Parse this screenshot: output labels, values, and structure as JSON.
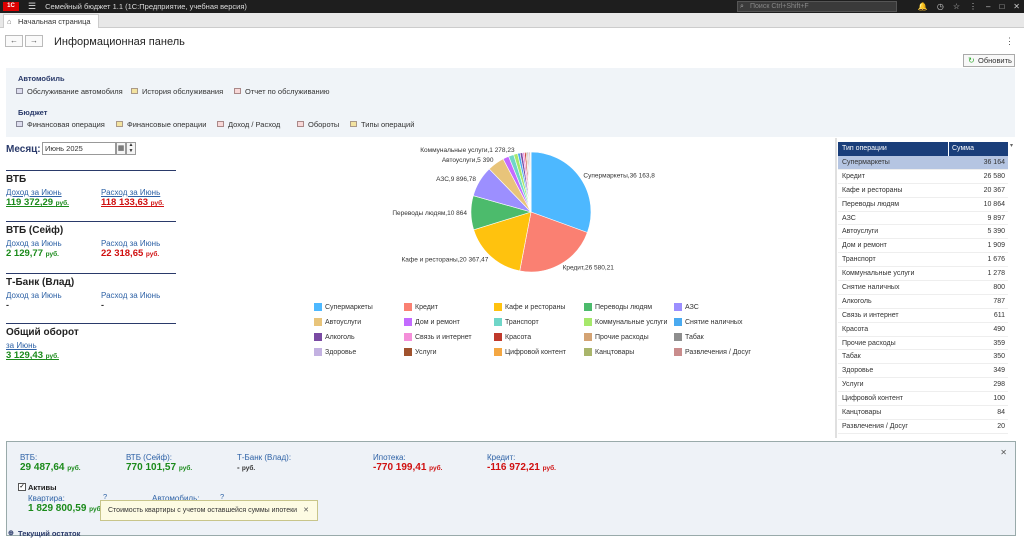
{
  "app": {
    "logo_text": "1C",
    "title": "Семейный бюджет 1.1  (1С:Предприятие, учебная версия)",
    "search_placeholder": "Поиск Ctrl+Shift+F"
  },
  "tabs": {
    "home": "Начальная страница"
  },
  "header": {
    "title": "Информационная панель",
    "refresh": "Обновить"
  },
  "nav_panel": {
    "auto_group": "Автомобиль",
    "auto_links": [
      "Обслуживание автомобиля",
      "История обслуживания",
      "Отчет по обслуживанию"
    ],
    "budget_group": "Бюджет",
    "budget_links": [
      "Финансовая операция",
      "Финансовые операции",
      "Доход / Расход",
      "Обороты",
      "Типы операций"
    ]
  },
  "month": {
    "label": "Месяц:",
    "value": "Июнь 2025"
  },
  "accounts": [
    {
      "name": "ВТБ",
      "income_label": "Доход за Июнь",
      "income": "119 372,29",
      "expense_label": "Расход за Июнь",
      "expense": "118 133,63",
      "currency": "руб."
    },
    {
      "name": "ВТБ (Сейф)",
      "income_label": "Доход за Июнь",
      "income": "2 129,77",
      "expense_label": "Расход за Июнь",
      "expense": "22 318,65",
      "currency": "руб."
    },
    {
      "name": "Т-Банк (Влад)",
      "income_label": "Доход за Июнь",
      "income": "-",
      "expense_label": "Расход за Июнь",
      "expense": "-"
    }
  ],
  "total": {
    "title": "Общий оборот",
    "label": "за Июнь",
    "value": "3 129,43",
    "currency": "руб."
  },
  "chart_data": {
    "type": "pie",
    "labels": [
      "Супермаркеты",
      "Кредит",
      "Кафе и рестораны",
      "Переводы людям",
      "АЗС",
      "Автоуслуги",
      "Дом и ремонт",
      "Транспорт",
      "Коммунальные услуги",
      "Снятие наличных",
      "Алкоголь",
      "Связь и интернет",
      "Красота",
      "Прочие расходы",
      "Табак",
      "Здоровье",
      "Услуги",
      "Цифровой контент",
      "Канцтовары",
      "Развлечения / Досуг"
    ],
    "values": [
      36163.8,
      26580.21,
      20367.47,
      10864,
      9896.78,
      5390,
      1909,
      1676,
      1278.23,
      800,
      787,
      611,
      490,
      359,
      350,
      349,
      298,
      100,
      84,
      20
    ],
    "slice_labels": [
      "Супермаркеты,36 163,8",
      "Кредит,26 580,21",
      "Кафе и рестораны,20 367,47",
      "Переводы людям,10 864",
      "АЗС,9 896,78",
      "Автоуслуги,5 390",
      "",
      "",
      "Коммунальные услуги,1 278,23",
      "",
      "",
      "",
      "",
      "",
      "",
      "",
      "",
      "",
      "",
      ""
    ],
    "colors": [
      "#4db8ff",
      "#fa8072",
      "#ffc20e",
      "#4cbb6c",
      "#9c8fff",
      "#e8c47a",
      "#c36bff",
      "#6fd6c8",
      "#a6e86b",
      "#4aaaf0",
      "#7a4aa3",
      "#f48fd9",
      "#c0392b",
      "#d4a373",
      "#8e8e8e",
      "#c3b1e1",
      "#a0522d",
      "#f4a742",
      "#a9b56b",
      "#c98c8c"
    ],
    "legend_position": "bottom"
  },
  "table": {
    "headers": [
      "Тип операции",
      "Сумма"
    ],
    "rows": [
      [
        "Супермаркеты",
        "36 164"
      ],
      [
        "Кредит",
        "26 580"
      ],
      [
        "Кафе и рестораны",
        "20 367"
      ],
      [
        "Переводы людям",
        "10 864"
      ],
      [
        "АЗС",
        "9 897"
      ],
      [
        "Автоуслуги",
        "5 390"
      ],
      [
        "Дом и ремонт",
        "1 909"
      ],
      [
        "Транспорт",
        "1 676"
      ],
      [
        "Коммунальные услуги",
        "1 278"
      ],
      [
        "Снятие наличных",
        "800"
      ],
      [
        "Алкоголь",
        "787"
      ],
      [
        "Связь и интернет",
        "611"
      ],
      [
        "Красота",
        "490"
      ],
      [
        "Прочие расходы",
        "359"
      ],
      [
        "Табак",
        "350"
      ],
      [
        "Здоровье",
        "349"
      ],
      [
        "Услуги",
        "298"
      ],
      [
        "Цифровой контент",
        "100"
      ],
      [
        "Канцтовары",
        "84"
      ],
      [
        "Развлечения / Досуг",
        "20"
      ]
    ]
  },
  "balances": {
    "vtb_label": "ВТБ:",
    "vtb": "29 487,64",
    "vtb_safe_label": "ВТБ (Сейф):",
    "vtb_safe": "770 101,57",
    "tbank_label": "Т-Банк (Влад):",
    "tbank": "-",
    "mortgage_label": "Ипотека:",
    "mortgage": "-770 199,41",
    "credit_label": "Кредит:",
    "credit": "-116 972,21",
    "currency": "руб."
  },
  "assets": {
    "title": "Активы",
    "apartment_label": "Квартира:",
    "apartment": "1 829 800,59",
    "car_label": "Автомобиль:",
    "q": "?",
    "currency": "руб."
  },
  "tooltip": "Стоимость квартиры с учетом оставшейся суммы ипотеки",
  "current_balance": "Текущий остаток"
}
